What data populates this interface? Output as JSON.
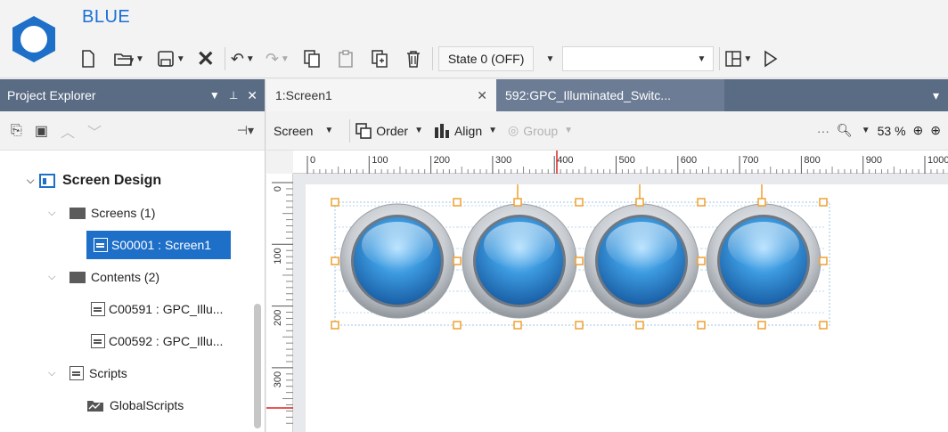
{
  "app": {
    "title": "BLUE"
  },
  "toolbar": {
    "state_label": "State 0 (OFF)",
    "icons": [
      "new-file-icon",
      "open-folder-icon",
      "save-icon",
      "delete-icon",
      "undo-icon",
      "redo-icon",
      "copy-icon",
      "paste-icon",
      "duplicate-icon",
      "trash-icon",
      "layout-icon",
      "play-icon"
    ]
  },
  "explorer": {
    "title": "Project Explorer",
    "tree": {
      "root": "Screen Design",
      "screens_label": "Screens (1)",
      "screen_item": "S00001 : Screen1",
      "contents_label": "Contents (2)",
      "content_items": [
        "C00591 : GPC_Illu...",
        "C00592 : GPC_Illu..."
      ],
      "scripts_label": "Scripts",
      "global_scripts": "GlobalScripts"
    }
  },
  "editor": {
    "tabs": [
      {
        "label": "1:Screen1",
        "active": true
      },
      {
        "label": "592:GPC_Illuminated_Switc...",
        "active": false
      }
    ],
    "toolbar": {
      "screen_label": "Screen",
      "order_label": "Order",
      "align_label": "Align",
      "group_label": "Group",
      "more_label": "···",
      "zoom_label": "53 %"
    },
    "ruler_h": [
      "0",
      "100",
      "200",
      "300",
      "400",
      "500",
      "600",
      "700",
      "800",
      "900",
      "1000"
    ],
    "ruler_v": [
      "0",
      "100",
      "200",
      "300"
    ],
    "buttons_count": 4
  },
  "colors": {
    "accent": "#1e6fc8",
    "panel_header": "#5a6b84",
    "selection_handle": "#f0a030",
    "button_blue": "#2f8fd8"
  }
}
